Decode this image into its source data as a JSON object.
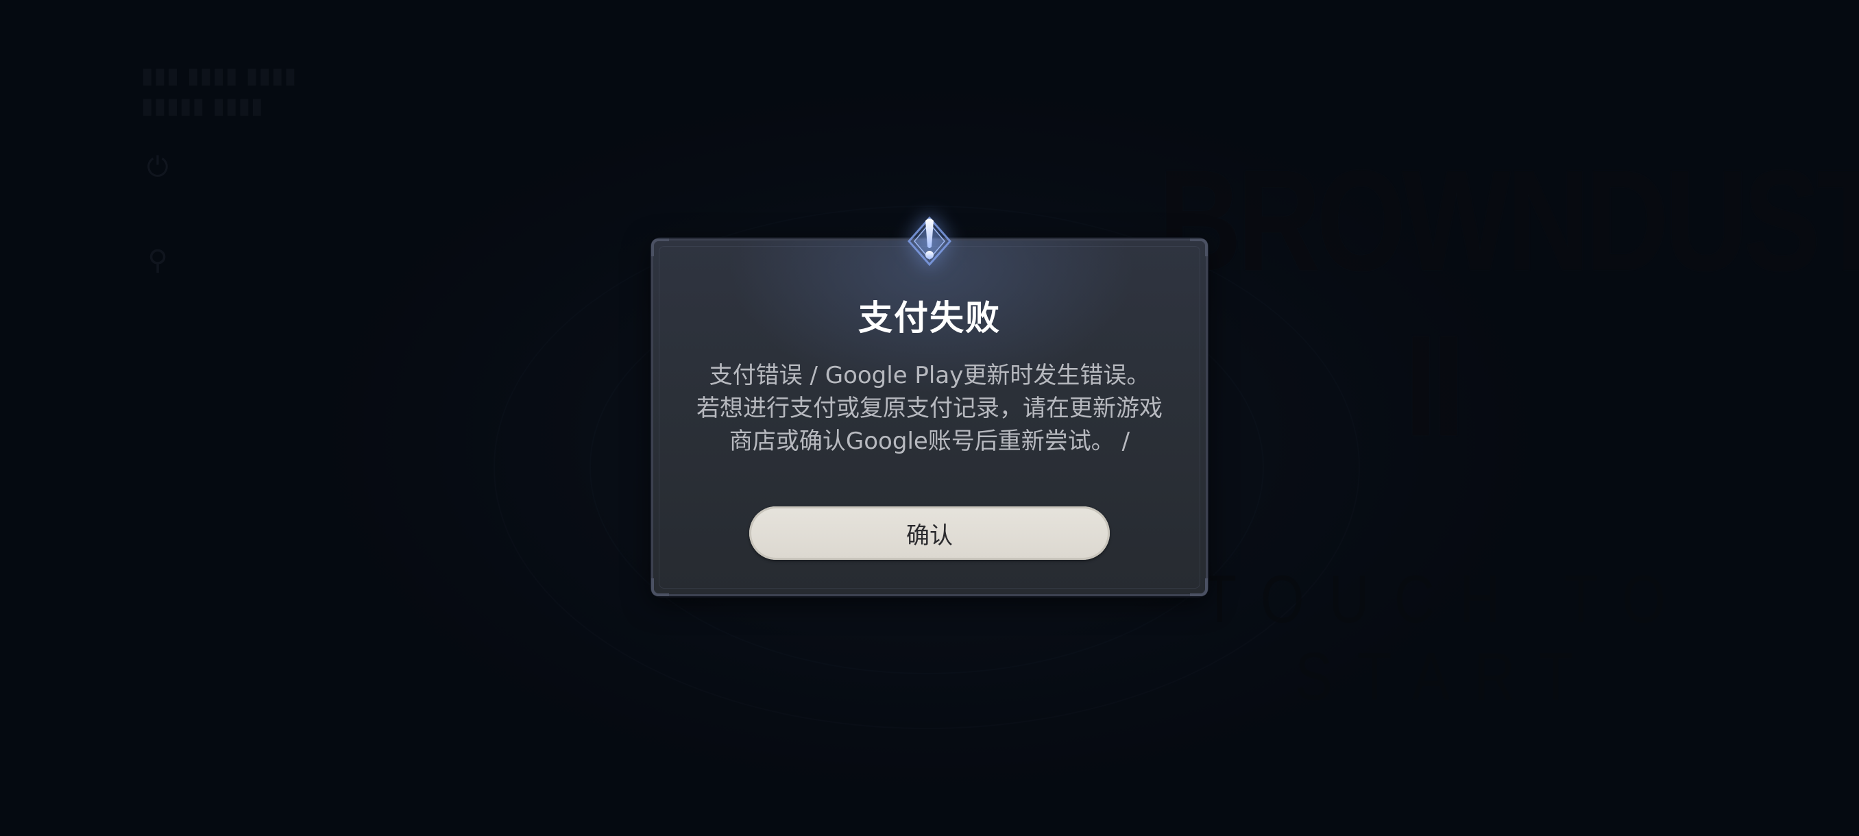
{
  "background": {
    "game_logo": "BROWNDUST II",
    "start_prompt": "TOUCH TO START",
    "icons": [
      "power-icon",
      "language-icon"
    ]
  },
  "dialog": {
    "icon": "exclamation-emblem-icon",
    "title": "支付失败",
    "message_lines": [
      "支付错误 / Google Play更新时发生错误。",
      "若想进行支付或复原支付记录，请在更新游戏",
      "商店或确认Google账号后重新尝试。 /"
    ],
    "confirm_label": "确认"
  },
  "colors": {
    "background": "#070b14",
    "dialog": "#2b3038",
    "title": "#ffffff",
    "message": "#b7b9bf",
    "button": "#e6e3dc",
    "emblem_glow": "#8aaaff"
  }
}
